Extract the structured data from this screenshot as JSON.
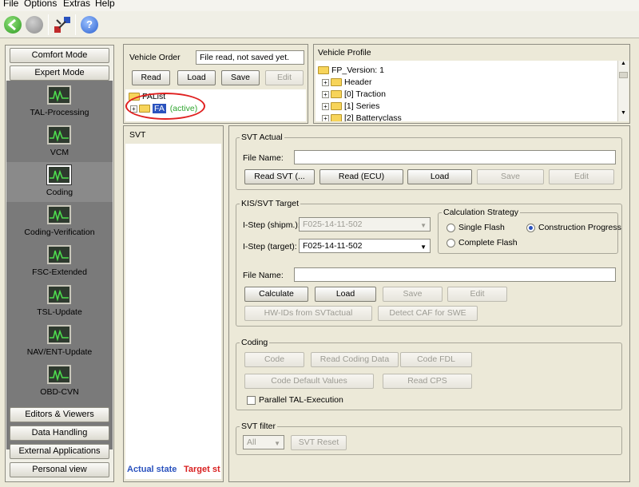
{
  "menubar": {
    "file": "File",
    "options": "Options",
    "extras": "Extras",
    "help": "Help"
  },
  "toolbar": {
    "back_icon": "back-arrow-icon",
    "forward_icon": "forward-icon",
    "tools_icon": "connection-icon",
    "help_icon": "help-icon"
  },
  "nav": {
    "comfort_mode": "Comfort Mode",
    "expert_mode": "Expert Mode",
    "modes": [
      {
        "label": "TAL-Processing"
      },
      {
        "label": "VCM"
      },
      {
        "label": "Coding"
      },
      {
        "label": "Coding-Verification"
      },
      {
        "label": "FSC-Extended"
      },
      {
        "label": "TSL-Update"
      },
      {
        "label": "NAV/ENT-Update"
      },
      {
        "label": "OBD-CVN"
      }
    ],
    "editors_viewers": "Editors & Viewers",
    "data_handling": "Data Handling",
    "external_apps": "External Applications",
    "personal_view": "Personal view"
  },
  "vehicle_order": {
    "label": "Vehicle Order",
    "status": "File read, not saved yet.",
    "read": "Read",
    "load": "Load",
    "save": "Save",
    "edit": "Edit",
    "tree_root": "FAList",
    "tree_child": "FA",
    "tree_child_status": "(active)"
  },
  "vehicle_profile": {
    "label": "Vehicle Profile",
    "items": [
      "FP_Version: 1",
      "Header",
      "[0] Traction",
      "[1] Series",
      "[2] Batteryclass"
    ]
  },
  "svt_panel": {
    "label": "SVT",
    "actual_state": "Actual state",
    "target_state": "Target st"
  },
  "svt_actual": {
    "title": "SVT Actual",
    "file_name_label": "File Name:",
    "file_name": "",
    "read_svt": "Read SVT (...",
    "read_ecu": "Read (ECU)",
    "load": "Load",
    "save": "Save",
    "edit": "Edit"
  },
  "kis_target": {
    "title": "KIS/SVT Target",
    "istep_shipm_label": "I-Step (shipm.):",
    "istep_shipm_value": "F025-14-11-502",
    "istep_target_label": "I-Step (target):",
    "istep_target_value": "F025-14-11-502",
    "calc_strategy_title": "Calculation Strategy",
    "single_flash": "Single Flash",
    "construction_progress": "Construction Progress",
    "complete_flash": "Complete Flash",
    "file_name_label": "File Name:",
    "file_name": "",
    "calculate": "Calculate",
    "load": "Load",
    "save": "Save",
    "edit": "Edit",
    "hw_ids": "HW-IDs from SVTactual",
    "detect_caf": "Detect CAF for SWE"
  },
  "coding": {
    "title": "Coding",
    "code": "Code",
    "read_coding_data": "Read Coding Data",
    "code_fdl": "Code FDL",
    "code_default_values": "Code Default Values",
    "read_cps": "Read CPS",
    "parallel_tal": "Parallel TAL-Execution"
  },
  "svt_filter": {
    "title": "SVT filter",
    "selected": "All",
    "reset": "SVT Reset"
  },
  "colors": {
    "accent_blue": "#2a52be",
    "active_green": "#2fa52f",
    "target_red": "#d92020",
    "highlight_circle": "#e02020"
  }
}
